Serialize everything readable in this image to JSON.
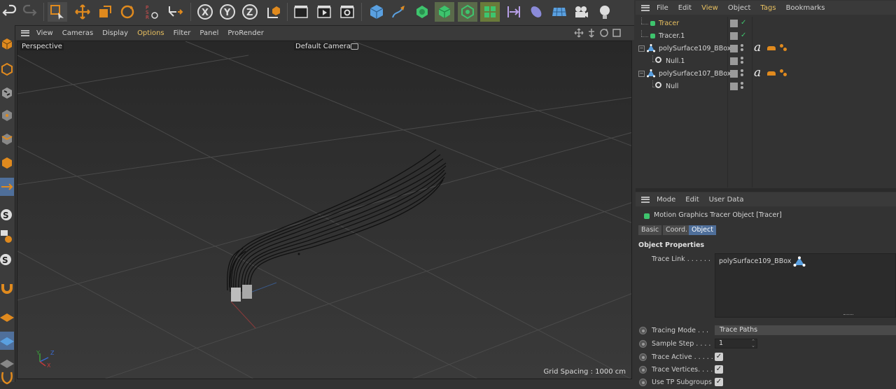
{
  "viewport_menu": {
    "items": [
      "View",
      "Cameras",
      "Display",
      "Options",
      "Filter",
      "Panel",
      "ProRender"
    ]
  },
  "viewport": {
    "projection_label": "Perspective",
    "camera_label": "Default Camera",
    "grid_spacing": "Grid Spacing : 1000 cm",
    "axis_x": "X",
    "axis_y": "Y",
    "axis_z": "Z"
  },
  "object_manager": {
    "menu": [
      "File",
      "Edit",
      "View",
      "Object",
      "Tags",
      "Bookmarks"
    ],
    "objects": [
      {
        "name": "Tracer",
        "highlight": true
      },
      {
        "name": "Tracer.1",
        "highlight": false
      },
      {
        "name": "polySurface109_BBox",
        "highlight": false
      },
      {
        "name": "Null.1",
        "highlight": false
      },
      {
        "name": "polySurface107_BBox",
        "highlight": false
      },
      {
        "name": "Null",
        "highlight": false
      }
    ]
  },
  "attribute_manager": {
    "menu": [
      "Mode",
      "Edit",
      "User Data"
    ],
    "object_title": "Motion Graphics Tracer Object [Tracer]",
    "tabs": [
      "Basic",
      "Coord.",
      "Object"
    ],
    "active_tab": "Object",
    "section_title": "Object Properties",
    "trace_link_label": "Trace Link . . . . . .",
    "trace_link_value": "polySurface109_BBox",
    "params": [
      {
        "label": "Tracing Mode . . .",
        "value": "Trace Paths",
        "kind": "dropdown"
      },
      {
        "label": "Sample Step . . . .",
        "value": "1",
        "kind": "number"
      },
      {
        "label": "Trace Active . . . . .",
        "value": true,
        "kind": "checkbox"
      },
      {
        "label": "Trace Vertices. . . .",
        "value": true,
        "kind": "checkbox"
      },
      {
        "label": "Use TP Subgroups",
        "value": true,
        "kind": "checkbox"
      }
    ]
  },
  "colors": {
    "accent_yellow": "#e8c060",
    "active_tab": "#4f6f9a",
    "tag_orange": "#e08a1e",
    "icon_blue": "#5aa0e0",
    "icon_green": "#3ec46d"
  }
}
